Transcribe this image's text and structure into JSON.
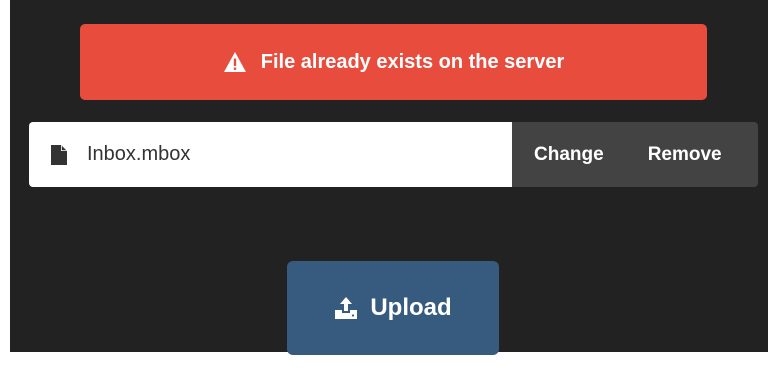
{
  "alert": {
    "icon": "warning-icon",
    "message": "File already exists on the server",
    "color": "#e84c3d"
  },
  "file": {
    "icon": "file-icon",
    "name": "Inbox.mbox",
    "change_label": "Change",
    "remove_label": "Remove"
  },
  "upload": {
    "icon": "upload-icon",
    "label": "Upload",
    "color": "#375a7f"
  },
  "colors": {
    "background": "#222222",
    "actions_bg": "#434343"
  }
}
